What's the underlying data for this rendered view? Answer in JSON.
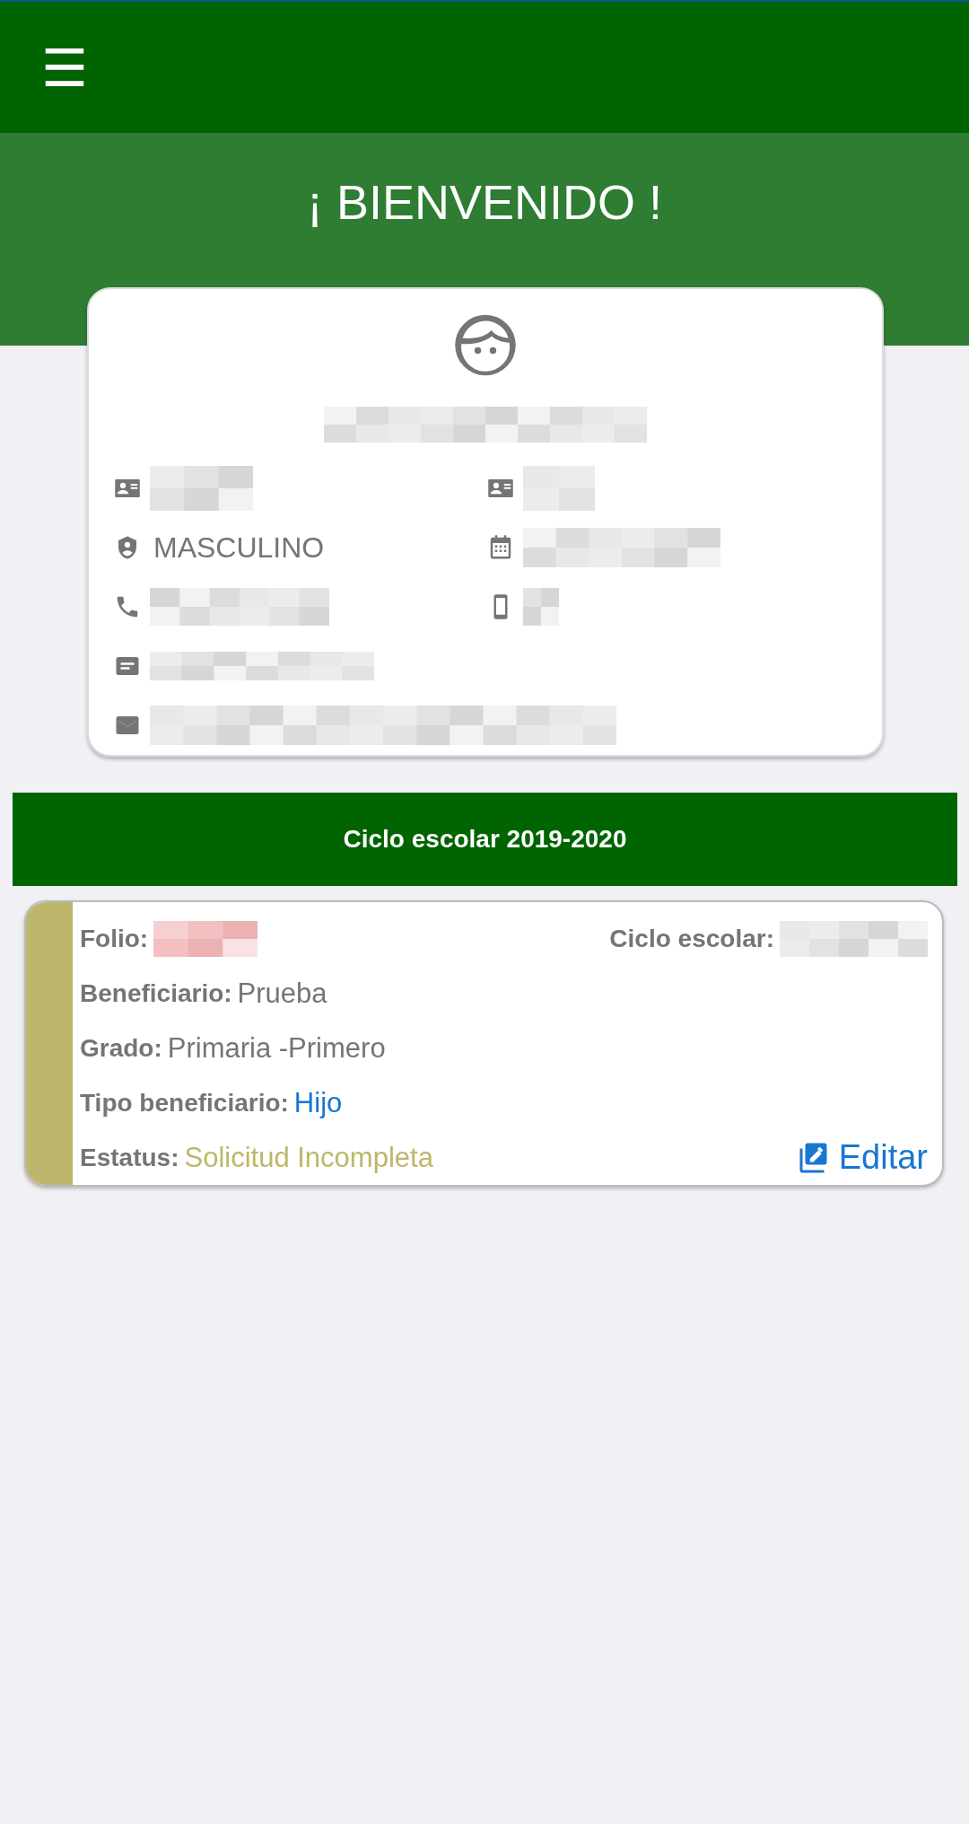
{
  "app_bar": {
    "menu": "☰"
  },
  "header": {
    "title": "¡ BIENVENIDO !"
  },
  "profile": {
    "fields": [
      {
        "kind": "redacted"
      },
      {
        "kind": "redacted"
      },
      {
        "kind": "text",
        "value": "MASCULINO"
      },
      {
        "kind": "redacted"
      },
      {
        "kind": "redacted"
      },
      {
        "kind": "redacted"
      },
      {
        "kind": "redacted"
      },
      {
        "kind": "redacted"
      }
    ]
  },
  "section": {
    "title": "Ciclo escolar 2019-2020"
  },
  "record": {
    "fields": [
      {
        "label": "Folio:",
        "kind": "redacted"
      },
      {
        "label": "Ciclo escolar:",
        "kind": "redacted"
      },
      {
        "label": "Beneficiario:",
        "kind": "text",
        "value": "Prueba",
        "color": "#757575"
      },
      {
        "label": "Grado:",
        "kind": "text",
        "value": "Primaria -Primero",
        "color": "#757575"
      },
      {
        "label": "Tipo beneficiario:",
        "kind": "text",
        "value": "Hijo",
        "color": "#1976d2"
      },
      {
        "label": "Estatus:",
        "kind": "text",
        "value": "Solicitud Incompleta",
        "color": "#bdb76b"
      }
    ],
    "edit_button": "Editar"
  }
}
